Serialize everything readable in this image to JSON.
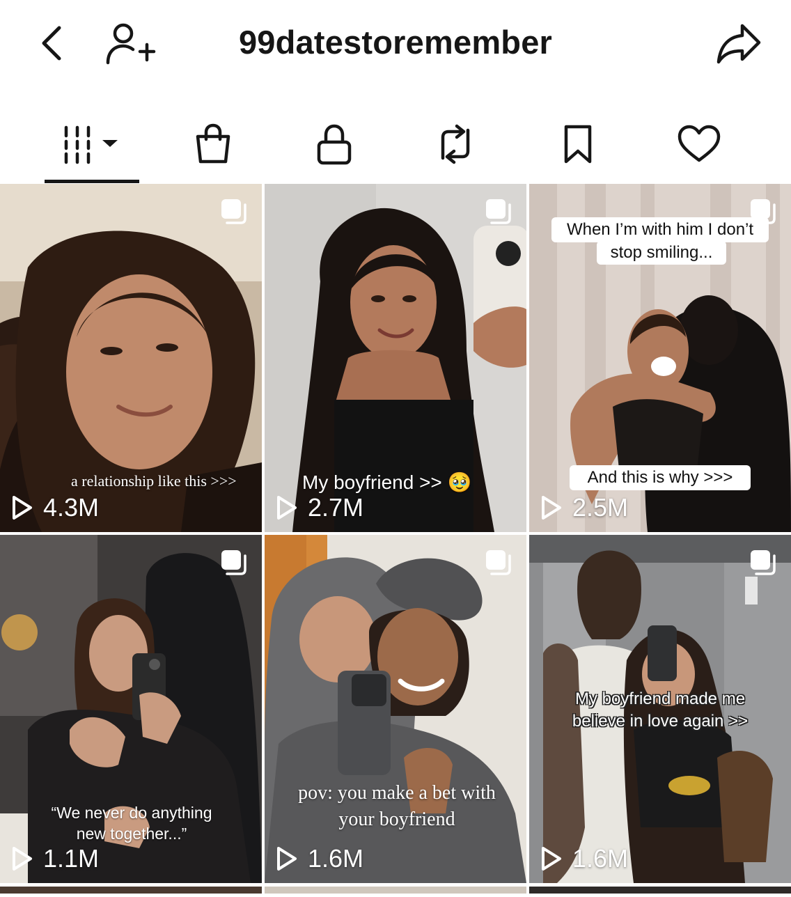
{
  "header": {
    "username": "99datestoremember"
  },
  "tabs": [
    {
      "icon": "videos-grid-icon",
      "active": true
    },
    {
      "icon": "shopping-bag-icon"
    },
    {
      "icon": "lock-icon"
    },
    {
      "icon": "repost-icon"
    },
    {
      "icon": "bookmark-icon"
    },
    {
      "icon": "heart-icon"
    }
  ],
  "videos": [
    {
      "views": "4.3M",
      "caption": "a relationship like this >>>"
    },
    {
      "views": "2.7M",
      "caption": "My boyfriend >> 🥹"
    },
    {
      "views": "2.5M",
      "caption_top": "When I’m with him I don’t stop smiling...",
      "caption_top_line1": "When I’m with him I don’t",
      "caption_top_line2": "stop smiling...",
      "caption_bottom": "And this is why >>>"
    },
    {
      "views": "1.1M",
      "caption_line1": "“We never do anything",
      "caption_line2": "new together...”"
    },
    {
      "views": "1.6M",
      "caption_line1": "pov: you make a bet with",
      "caption_line2": "your boyfriend"
    },
    {
      "views": "1.6M",
      "caption_line1": "My boyfriend made me",
      "caption_line2": "believe in love again >>"
    }
  ],
  "colors": {
    "text": "#161616",
    "background": "#ffffff"
  }
}
